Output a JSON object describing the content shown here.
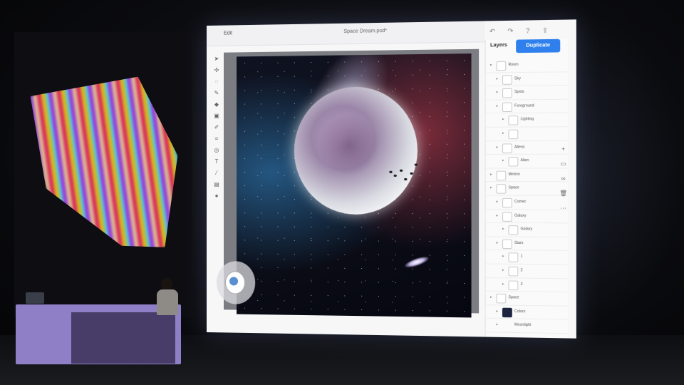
{
  "app": {
    "edit_label": "Edit",
    "doc_title": "Space Dream.psd*"
  },
  "toolbar": {
    "tools": [
      "move",
      "select",
      "brush",
      "eraser",
      "fill",
      "crop",
      "text",
      "eyedropper",
      "transform",
      "layers",
      "mask",
      "color"
    ]
  },
  "layers_panel": {
    "title": "Layers",
    "duplicate_label": "Duplicate",
    "rows": [
      {
        "label": "Room",
        "depth": 0,
        "thumb": "light"
      },
      {
        "label": "Sky",
        "depth": 1,
        "thumb": "light"
      },
      {
        "label": "Spots",
        "depth": 1,
        "thumb": "light"
      },
      {
        "label": "Foreground",
        "depth": 1,
        "thumb": "light"
      },
      {
        "label": "Lighting",
        "depth": 2,
        "thumb": "light"
      },
      {
        "label": "",
        "depth": 2,
        "thumb": "light"
      },
      {
        "label": "Aliens",
        "depth": 1,
        "thumb": "light"
      },
      {
        "label": "Alien",
        "depth": 2,
        "thumb": "light"
      },
      {
        "label": "Meteor",
        "depth": 0,
        "thumb": "light"
      },
      {
        "label": "Space",
        "depth": 0,
        "thumb": "light"
      },
      {
        "label": "Comet",
        "depth": 1,
        "thumb": "light"
      },
      {
        "label": "Galaxy",
        "depth": 1,
        "thumb": "light"
      },
      {
        "label": "Galaxy",
        "depth": 2,
        "thumb": "light"
      },
      {
        "label": "Stars",
        "depth": 1,
        "thumb": "light"
      },
      {
        "label": "1",
        "depth": 2,
        "thumb": "light"
      },
      {
        "label": "2",
        "depth": 2,
        "thumb": "light"
      },
      {
        "label": "3",
        "depth": 2,
        "thumb": "light"
      },
      {
        "label": "Space",
        "depth": 0,
        "thumb": "light"
      },
      {
        "label": "Colors",
        "depth": 1,
        "thumb": "dark"
      },
      {
        "label": "Moonlight",
        "depth": 1,
        "thumb": "none"
      }
    ]
  },
  "right_icons": [
    "plus-icon",
    "mask-icon",
    "link-icon",
    "trash-icon",
    "more-icon"
  ],
  "top_icons": [
    "undo-icon",
    "redo-icon",
    "help-icon",
    "share-icon",
    "cloud-icon"
  ],
  "colors": {
    "accent": "#2f80ed",
    "podium": "#8f7fc6"
  }
}
